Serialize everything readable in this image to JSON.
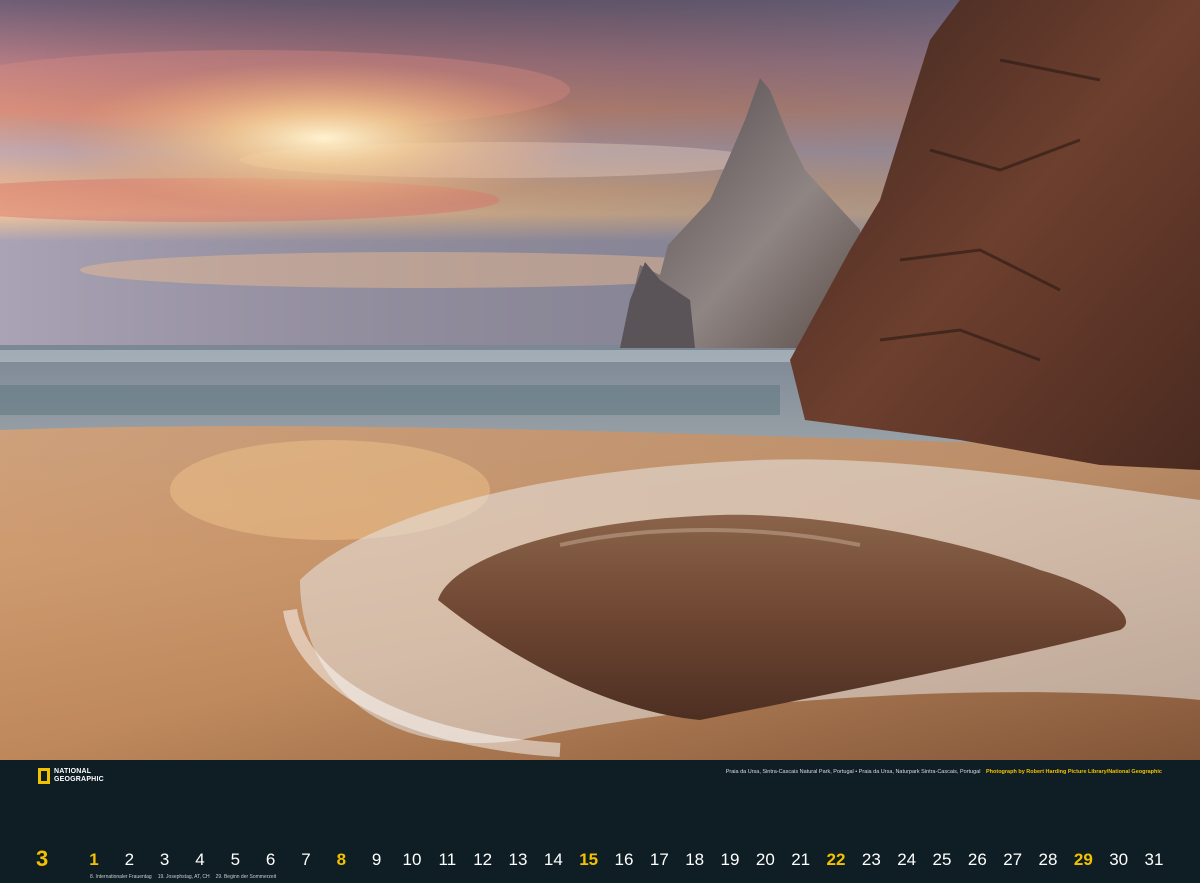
{
  "photo": {
    "caption_location": "Praia da Ursa, Sintra-Cascais Natural Park, Portugal • Praia da Ursa, Naturpark Sintra-Cascais, Portugal",
    "caption_credit": "Photograph by Robert Harding Picture Library/National Geographic"
  },
  "brand": {
    "logo_line1": "NATIONAL",
    "logo_line2": "GEOGRAPHIC",
    "logo_color": "#f2c200"
  },
  "calendar": {
    "month_number": "3",
    "highlight_color": "#f2c200",
    "days": [
      {
        "label": "1",
        "highlight": true
      },
      {
        "label": "2",
        "highlight": false
      },
      {
        "label": "3",
        "highlight": false
      },
      {
        "label": "4",
        "highlight": false
      },
      {
        "label": "5",
        "highlight": false
      },
      {
        "label": "6",
        "highlight": false
      },
      {
        "label": "7",
        "highlight": false
      },
      {
        "label": "8",
        "highlight": true
      },
      {
        "label": "9",
        "highlight": false
      },
      {
        "label": "10",
        "highlight": false
      },
      {
        "label": "11",
        "highlight": false
      },
      {
        "label": "12",
        "highlight": false
      },
      {
        "label": "13",
        "highlight": false
      },
      {
        "label": "14",
        "highlight": false
      },
      {
        "label": "15",
        "highlight": true
      },
      {
        "label": "16",
        "highlight": false
      },
      {
        "label": "17",
        "highlight": false
      },
      {
        "label": "18",
        "highlight": false
      },
      {
        "label": "19",
        "highlight": false
      },
      {
        "label": "20",
        "highlight": false
      },
      {
        "label": "21",
        "highlight": false
      },
      {
        "label": "22",
        "highlight": true
      },
      {
        "label": "23",
        "highlight": false
      },
      {
        "label": "24",
        "highlight": false
      },
      {
        "label": "25",
        "highlight": false
      },
      {
        "label": "26",
        "highlight": false
      },
      {
        "label": "27",
        "highlight": false
      },
      {
        "label": "28",
        "highlight": false
      },
      {
        "label": "29",
        "highlight": true
      },
      {
        "label": "30",
        "highlight": false
      },
      {
        "label": "31",
        "highlight": false
      }
    ],
    "holidays": [
      "8. Internationaler Frauentag",
      "19. Josephstag, AT, CH",
      "29. Beginn der Sommerzeit"
    ]
  }
}
